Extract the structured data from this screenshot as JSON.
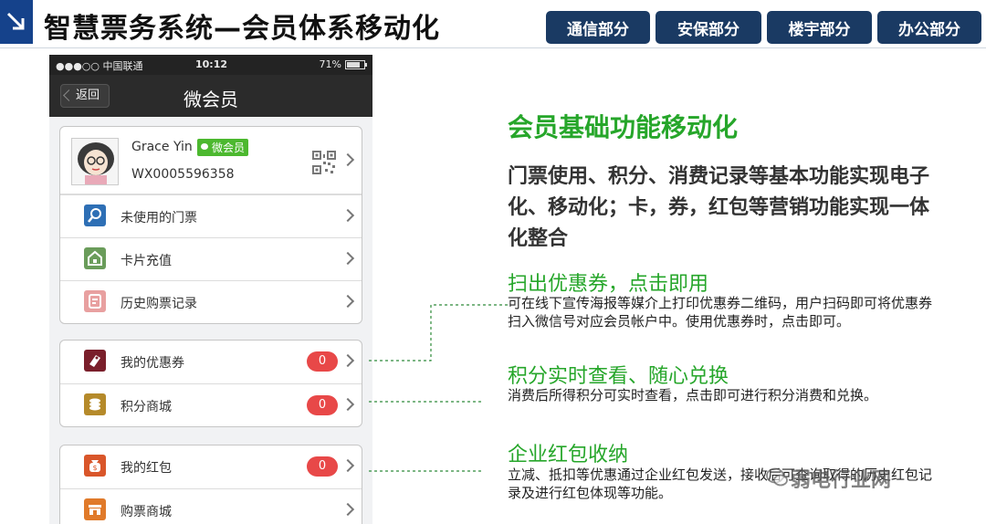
{
  "header": {
    "title": "智慧票务系统—会员体系移动化",
    "nav_tabs": [
      "通信部分",
      "安保部分",
      "楼宇部分",
      "办公部分"
    ],
    "accent": "#1a3a63"
  },
  "phone": {
    "status": {
      "carrier": "●●●○○ 中国联通",
      "time": "10:12",
      "battery": "71%"
    },
    "nav": {
      "back": "返回",
      "title": "微会员"
    },
    "profile": {
      "name": "Grace Yin",
      "tag": "微会员",
      "id": "WX0005596358"
    },
    "group1": [
      {
        "label": "未使用的门票",
        "icon": "search-ticket-icon",
        "color": "#2e6fb5"
      },
      {
        "label": "卡片充值",
        "icon": "card-recharge-icon",
        "color": "#6a9c5a"
      },
      {
        "label": "历史购票记录",
        "icon": "history-icon",
        "color": "#e8a0a0"
      }
    ],
    "group2": [
      {
        "label": "我的优惠券",
        "icon": "coupon-icon",
        "color": "#7a1f2b",
        "badge": "0"
      },
      {
        "label": "积分商城",
        "icon": "points-icon",
        "color": "#b58a2a",
        "badge": "0"
      }
    ],
    "group3": [
      {
        "label": "我的红包",
        "icon": "red-packet-icon",
        "color": "#d9562a",
        "badge": "0"
      },
      {
        "label": "购票商城",
        "icon": "shop-icon",
        "color": "#e07a2a"
      }
    ]
  },
  "content": {
    "headline": "会员基础功能移动化",
    "lead": "门票使用、积分、消费记录等基本功能实现电子化、移动化；卡，券，红包等营销功能实现一体化整合",
    "sections": [
      {
        "title": "扫出优惠券，点击即用",
        "body": "可在线下宣传海报等媒介上打印优惠券二维码，用户扫码即可将优惠券扫入微信号对应会员帐户中。使用优惠券时，点击即可。"
      },
      {
        "title": "积分实时查看、随心兑换",
        "body": "消费后所得积分可实时查看，点击即可进行积分消费和兑换。"
      },
      {
        "title": "企业红包收纳",
        "body": "立减、抵扣等优惠通过企业红包发送，接收后可查询取得的历史红包记录及进行红包体现等功能。"
      }
    ],
    "green": "#26a62a"
  },
  "watermark": "弱电行业网"
}
